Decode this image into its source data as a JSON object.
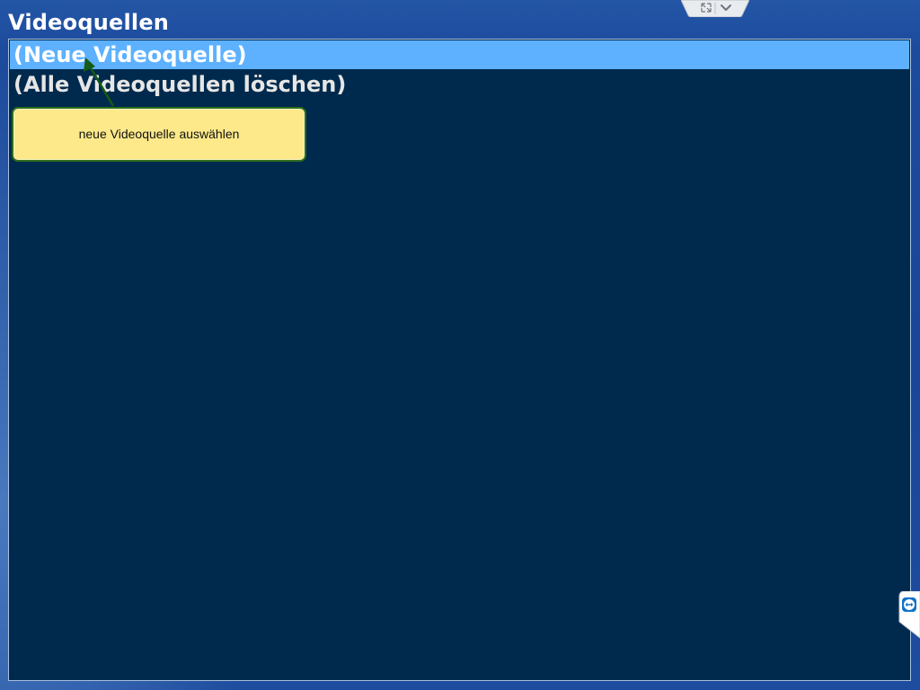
{
  "window": {
    "title": "Videoquellen"
  },
  "list": {
    "items": [
      {
        "label": "(Neue Videoquelle)",
        "selected": true
      },
      {
        "label": "(Alle Videoquellen löschen)",
        "selected": false
      }
    ]
  },
  "tooltip": {
    "text": "neue Videoquelle auswählen"
  },
  "remote_toolbar": {
    "icons": [
      "fullscreen-icon",
      "chevron-down-icon"
    ]
  },
  "side_widget": {
    "icon": "teamviewer-icon"
  },
  "colors": {
    "desktop_blue": "#1c4a9c",
    "panel_background": "#002a4d",
    "selection_highlight": "#5db1ff",
    "tooltip_fill": "#fde98a",
    "tooltip_border": "#2f6b1e"
  }
}
